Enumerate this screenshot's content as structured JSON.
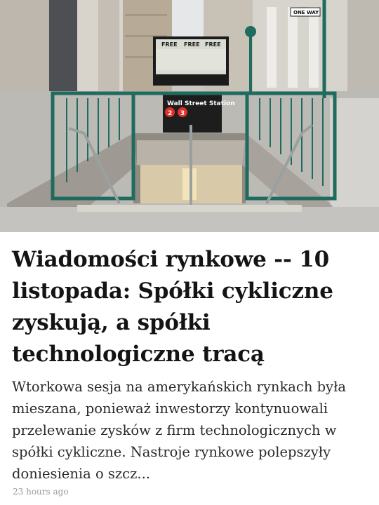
{
  "article": {
    "headline": "Wiadomości rynkowe -- 10 listopada: Spółki cykliczne zyskują, a spółki technologiczne tracą",
    "summary": "Wtorkowa sesja na amerykańskich rynkach była mieszana, ponieważ inwestorzy kontynuowali przelewanie zysków z firm technologicznych w spółki cykliczne. Nastroje rynkowe polepszyły doniesienia o szcz...",
    "timestamp": "23 hours ago"
  },
  "image": {
    "station_sign": "Wall Street Station",
    "line_badges": [
      "2",
      "3"
    ],
    "street_sign": "ONE WAY",
    "billboard_word": "FREE"
  },
  "colors": {
    "railing": "#1f6b5e",
    "badge": "#e1302b",
    "headline": "#141414",
    "summary": "#2a2a2a",
    "timestamp": "#9a9a9a"
  }
}
